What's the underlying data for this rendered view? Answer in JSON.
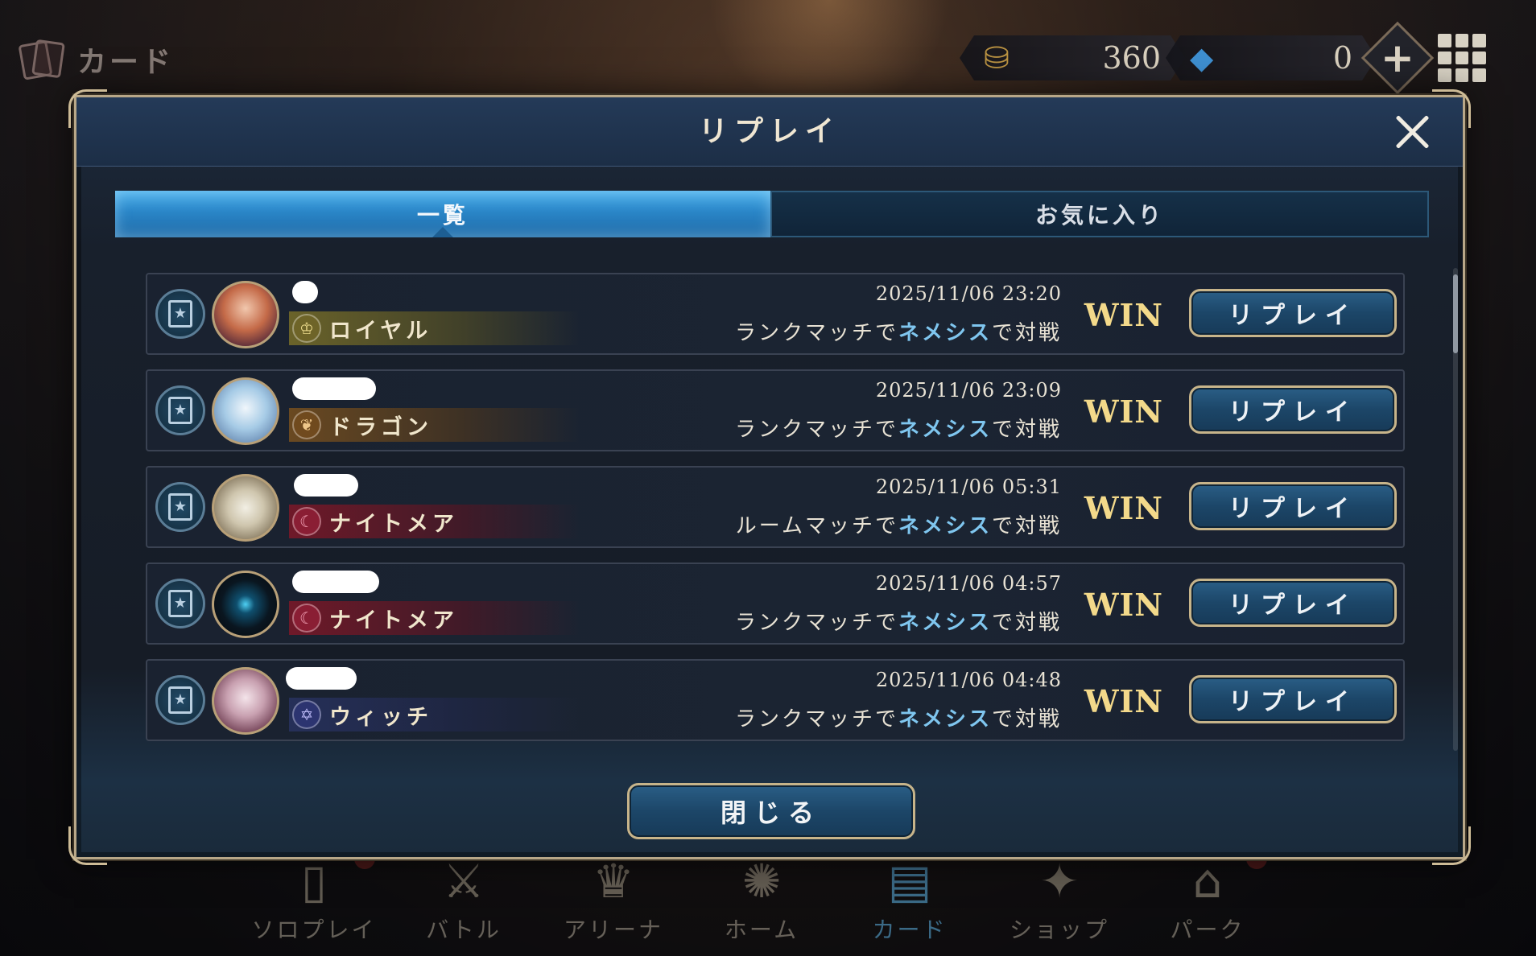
{
  "topbar": {
    "screen_title": "カード",
    "gold_amount": "360",
    "crystal_amount": "0",
    "add_symbol": "+"
  },
  "modal": {
    "title": "リプレイ",
    "tabs": [
      {
        "label": "一覧",
        "active": true
      },
      {
        "label": "お気に入り",
        "active": false
      }
    ],
    "rows": [
      {
        "class_name": "ロイヤル",
        "class_icon": "crown-icon",
        "datetime": "2025/11/06 23:20",
        "match_prefix": "ランクマッチで",
        "match_format": "ネメシス",
        "match_suffix": "で対戦",
        "result": "WIN",
        "button": "リプレイ"
      },
      {
        "class_name": "ドラゴン",
        "class_icon": "dragon-icon",
        "datetime": "2025/11/06 23:09",
        "match_prefix": "ランクマッチで",
        "match_format": "ネメシス",
        "match_suffix": "で対戦",
        "result": "WIN",
        "button": "リプレイ"
      },
      {
        "class_name": "ナイトメア",
        "class_icon": "nightmare-icon",
        "datetime": "2025/11/06 05:31",
        "match_prefix": "ルームマッチで",
        "match_format": "ネメシス",
        "match_suffix": "で対戦",
        "result": "WIN",
        "button": "リプレイ"
      },
      {
        "class_name": "ナイトメア",
        "class_icon": "nightmare-icon",
        "datetime": "2025/11/06 04:57",
        "match_prefix": "ランクマッチで",
        "match_format": "ネメシス",
        "match_suffix": "で対戦",
        "result": "WIN",
        "button": "リプレイ"
      },
      {
        "class_name": "ウィッチ",
        "class_icon": "witch-icon",
        "datetime": "2025/11/06 04:48",
        "match_prefix": "ランクマッチで",
        "match_format": "ネメシス",
        "match_suffix": "で対戦",
        "result": "WIN",
        "button": "リプレイ"
      }
    ],
    "close_label": "閉じる"
  },
  "bottom_nav": [
    {
      "label": "ソロプレイ",
      "icon": "solo-play-icon",
      "active": false
    },
    {
      "label": "バトル",
      "icon": "crossed-swords-icon",
      "active": false
    },
    {
      "label": "アリーナ",
      "icon": "trophy-icon",
      "active": false
    },
    {
      "label": "ホーム",
      "icon": "home-emblem-icon",
      "active": false
    },
    {
      "label": "カード",
      "icon": "cards-icon",
      "active": true
    },
    {
      "label": "ショップ",
      "icon": "shop-icon",
      "active": false
    },
    {
      "label": "パーク",
      "icon": "park-icon",
      "active": false
    }
  ],
  "colors": {
    "accent_blue": "#2a86c8",
    "win_gold": "#f3d98a",
    "format_highlight": "#7fc6ef",
    "frame_gold": "#b8a788"
  }
}
